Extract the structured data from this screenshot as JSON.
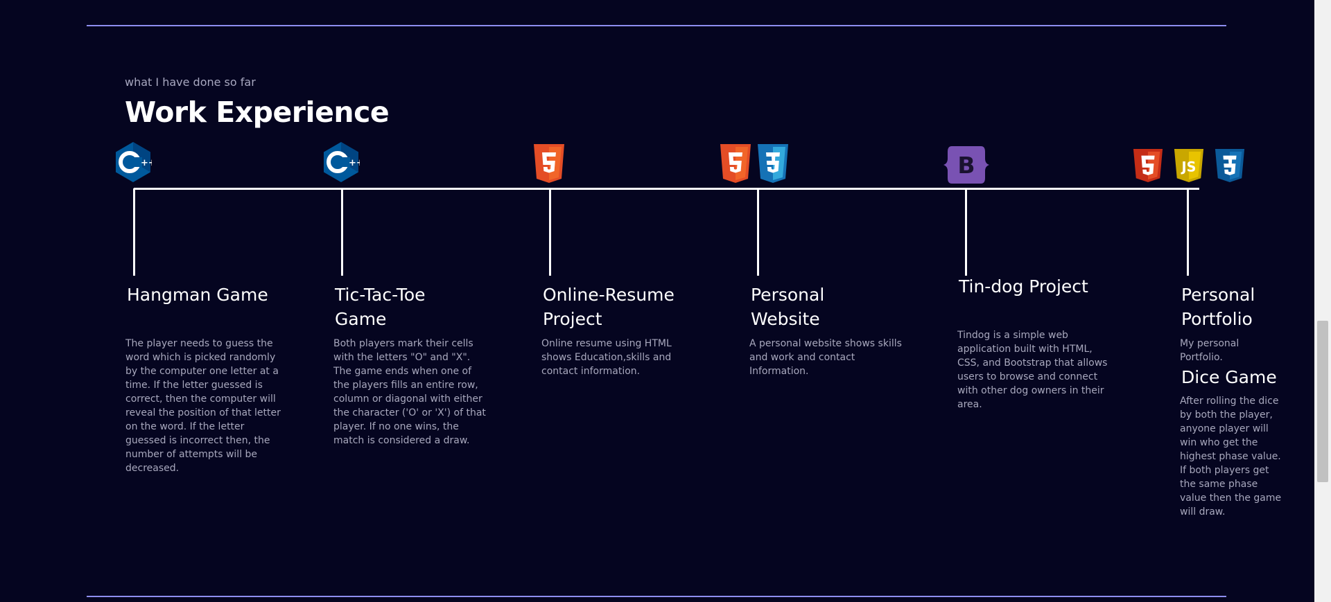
{
  "section": {
    "subtitle": "what I have done so far",
    "title": "Work Experience"
  },
  "items": [
    {
      "title": "Hangman Game",
      "description": "The player needs to guess the word which is picked randomly by the computer one letter at a time. If the letter guessed is correct, then the computer will reveal the position of that letter on the word. If the letter guessed is incorrect then, the number of attempts will be decreased.",
      "icons": [
        "cpp-icon"
      ]
    },
    {
      "title": "Tic-Tac-Toe Game",
      "description": "Both players mark their cells with the letters \"O\" and \"X\". The game ends when one of the players fills an entire row, column or diagonal with either the character ('O' or 'X') of that player. If no one wins, the match is considered a draw.",
      "icons": [
        "cpp-icon"
      ]
    },
    {
      "title": "Online-Resume Project",
      "description": "Online resume using HTML shows Education,skills and contact information.",
      "icons": [
        "html5-icon"
      ]
    },
    {
      "title": "Personal Website",
      "description": "A personal website shows skills and work and contact Information.",
      "icons": [
        "html5-icon",
        "css3-icon"
      ]
    },
    {
      "title": "Tin-dog Project",
      "description": "Tindog is a simple web application built with HTML, CSS, and Bootstrap that allows users to browse and connect with other dog owners in their area.",
      "icons": [
        "bootstrap-icon"
      ]
    },
    {
      "title": "Personal Portfolio",
      "description": "My personal Portfolio.",
      "extra_title": "Dice Game",
      "extra_description": "After rolling the dice by both the player, anyone player will win who get the highest phase value. If both players get the same phase value then the game will draw.",
      "icons": [
        "html5-icon",
        "javascript-icon",
        "css3-icon"
      ]
    }
  ],
  "colors": {
    "background": "#050520",
    "divider": "#8e8ef0",
    "muted_text": "#a8a8bd",
    "html5": "#e44d26",
    "css3": "#1572b6",
    "javascript": "#f0db4f",
    "bootstrap": "#7952b3",
    "cpp": "#00599c"
  }
}
